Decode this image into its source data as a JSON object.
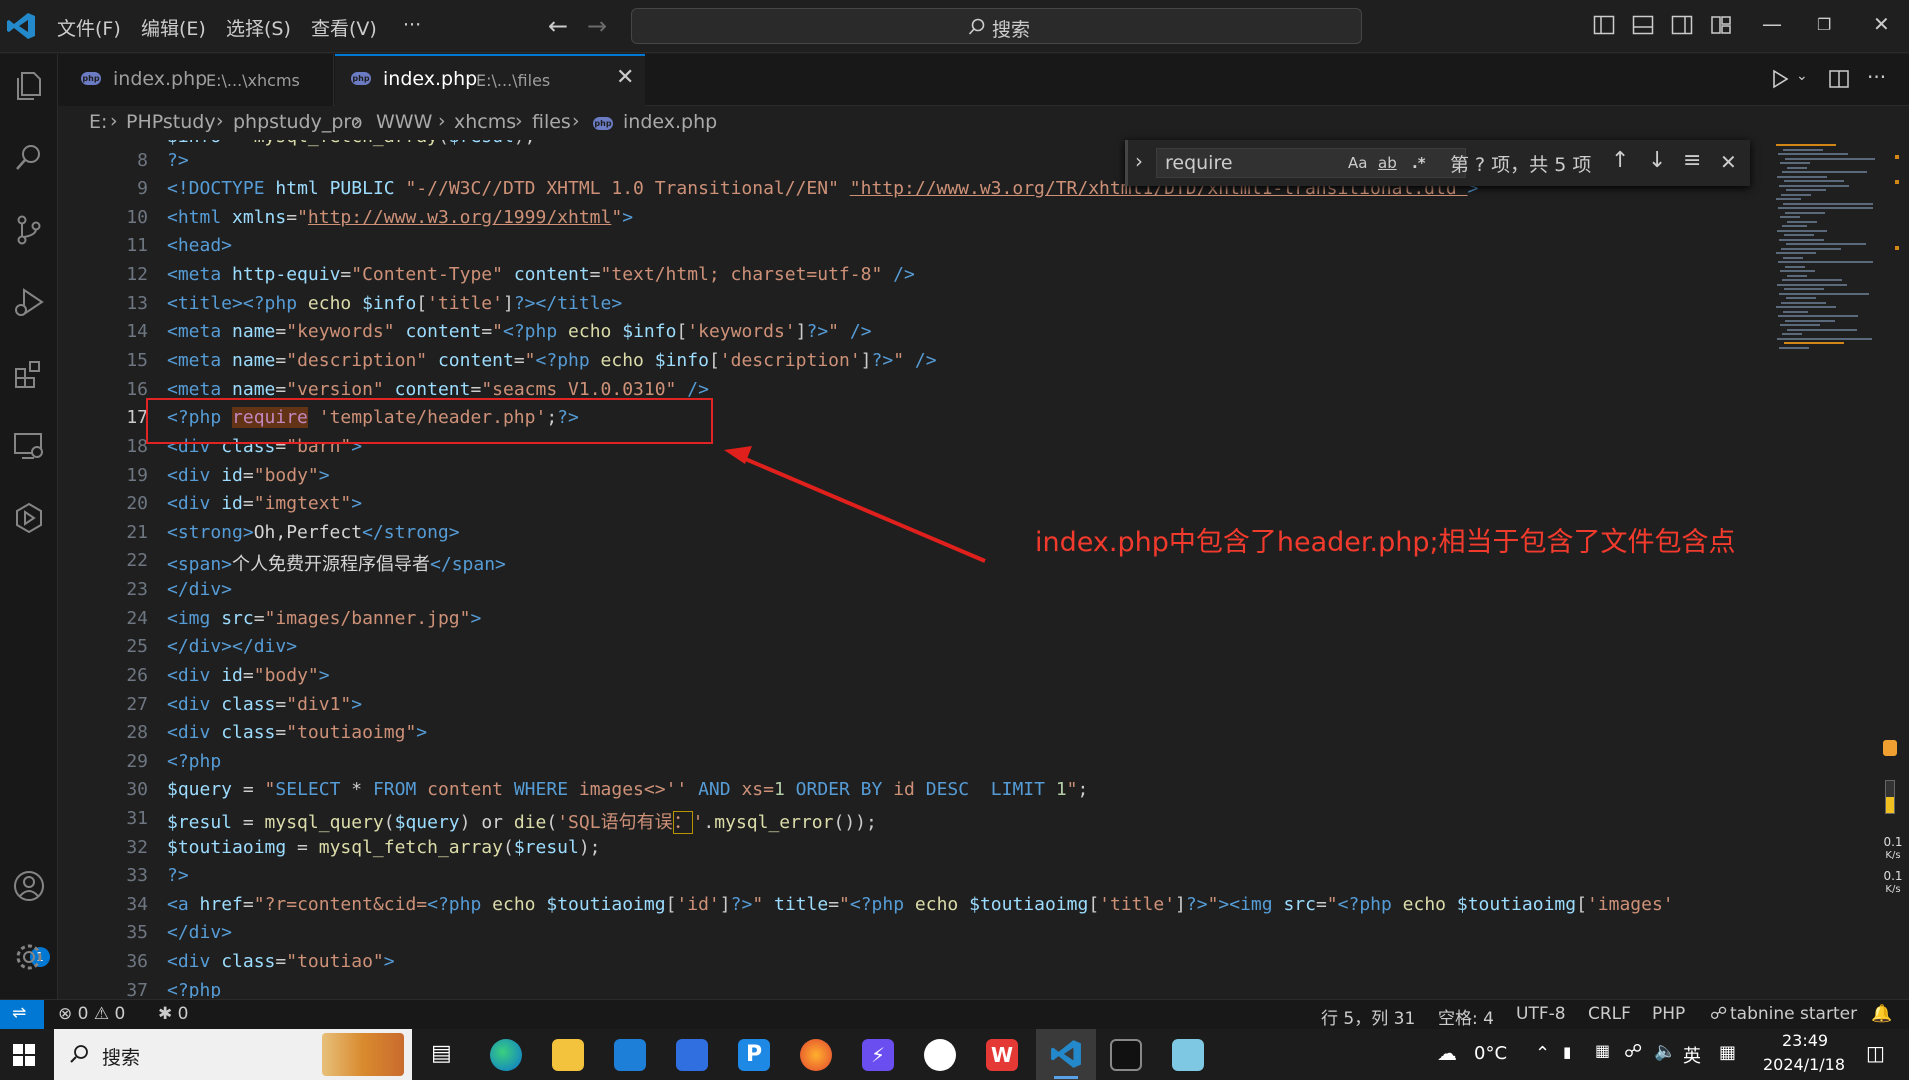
{
  "titlebar": {
    "menus": [
      "文件(F)",
      "编辑(E)",
      "选择(S)",
      "查看(V)",
      "···"
    ],
    "search_label": "搜索"
  },
  "tabs": [
    {
      "name": "index.php",
      "path": "E:\\...\\xhcms",
      "active": false
    },
    {
      "name": "index.php",
      "path": "E:\\...\\files",
      "active": true
    }
  ],
  "breadcrumb": [
    "E:",
    "PHPstudy",
    "phpstudy_pro",
    "WWW",
    "xhcms",
    "files",
    "index.php"
  ],
  "editor": {
    "lines": [
      "8",
      "9",
      "10",
      "11",
      "12",
      "13",
      "14",
      "15",
      "16",
      "17",
      "18",
      "19",
      "20",
      "21",
      "22",
      "23",
      "24",
      "25",
      "26",
      "27",
      "28",
      "29",
      "30",
      "31",
      "32",
      "33",
      "34",
      "35",
      "36",
      "37"
    ]
  },
  "find": {
    "query": "require",
    "opt_case": "Aa",
    "opt_word": "ab",
    "opt_regex": ".*",
    "result": "第 ? 项，共 5 项"
  },
  "annotation": {
    "text": "index.php中包含了header.php;相当于包含了文件包含点"
  },
  "activity_badge": "1",
  "netspeed": [
    {
      "value": "0.1",
      "unit": "K/s"
    },
    {
      "value": "0.1",
      "unit": "K/s"
    }
  ],
  "statusbar": {
    "errors": "0",
    "warnings": "0",
    "ports": "0",
    "position": "行 5，列 31",
    "spaces": "空格: 4",
    "encoding": "UTF-8",
    "eol": "CRLF",
    "language": "PHP",
    "tabnine": "tabnine starter"
  },
  "taskbar": {
    "search_label": "搜索",
    "weather": "0°C",
    "ime": "英",
    "time": "23:49",
    "date": "2024/1/18"
  },
  "colors": {
    "accent": "#0078d4",
    "annotation": "#f23a2d",
    "editor_bg": "#1f1f1f"
  }
}
